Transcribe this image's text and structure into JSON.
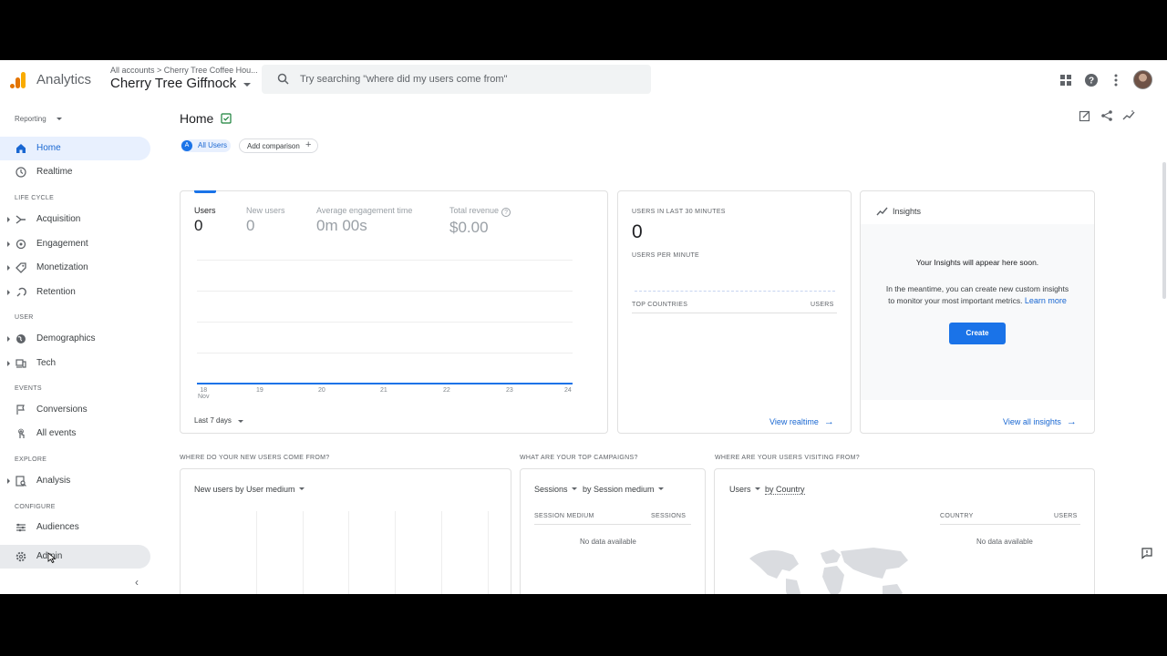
{
  "app": {
    "brand": "Analytics",
    "account_path": "All accounts > Cherry Tree Coffee Hou...",
    "property_name": "Cherry Tree Giffnock",
    "search_placeholder": "Try searching \"where did my users come from\""
  },
  "sidebar": {
    "reporting_label": "Reporting",
    "items": {
      "home": "Home",
      "realtime": "Realtime",
      "acquisition": "Acquisition",
      "engagement": "Engagement",
      "monetization": "Monetization",
      "retention": "Retention",
      "demographics": "Demographics",
      "tech": "Tech",
      "conversions": "Conversions",
      "all_events": "All events",
      "analysis": "Analysis",
      "audiences": "Audiences",
      "admin": "Admin"
    },
    "sections": {
      "lifecycle": "LIFE CYCLE",
      "user": "USER",
      "events": "EVENTS",
      "explore": "EXPLORE",
      "configure": "CONFIGURE"
    },
    "collapse_glyph": "‹"
  },
  "page": {
    "title": "Home",
    "chip_all_users_letter": "A",
    "chip_all_users": "All Users",
    "add_comparison": "Add comparison",
    "add_glyph": "+"
  },
  "overview": {
    "metrics": [
      {
        "label": "Users",
        "value": "0"
      },
      {
        "label": "New users",
        "value": "0"
      },
      {
        "label": "Average engagement time",
        "value": "0m 00s"
      },
      {
        "label": "Total revenue",
        "value": "$0.00"
      }
    ],
    "help_glyph": "?",
    "x_ticks": [
      "18",
      "19",
      "20",
      "21",
      "22",
      "23",
      "24"
    ],
    "x_month": "Nov",
    "date_range": "Last 7 days"
  },
  "realtime": {
    "users_label": "USERS IN LAST 30 MINUTES",
    "users_value": "0",
    "per_minute_label": "USERS PER MINUTE",
    "top_countries": "TOP COUNTRIES",
    "users_col": "USERS",
    "view_link": "View realtime"
  },
  "insights": {
    "title": "Insights",
    "headline": "Your Insights will appear here soon.",
    "body_line1": "In the meantime, you can create new custom insights",
    "body_line2": "to monitor your most important metrics.",
    "learn_more": "Learn more",
    "create_button": "Create",
    "view_all": "View all insights"
  },
  "sections": {
    "new_users_title": "WHERE DO YOUR NEW USERS COME FROM?",
    "campaigns_title": "WHAT ARE YOUR TOP CAMPAIGNS?",
    "visiting_title": "WHERE ARE YOUR USERS VISITING FROM?",
    "new_users_dd": "New users by User medium",
    "sessions_dd": "Sessions",
    "by_session_medium": "by Session medium",
    "session_medium_col": "SESSION MEDIUM",
    "sessions_col": "SESSIONS",
    "users_dd": "Users",
    "by_country": "by Country",
    "country_col": "COUNTRY",
    "users_col": "USERS",
    "no_data": "No data available"
  },
  "arrow_glyph": "→",
  "colors": {
    "accent": "#1a73e8",
    "active_bg": "#e8f0fe"
  }
}
